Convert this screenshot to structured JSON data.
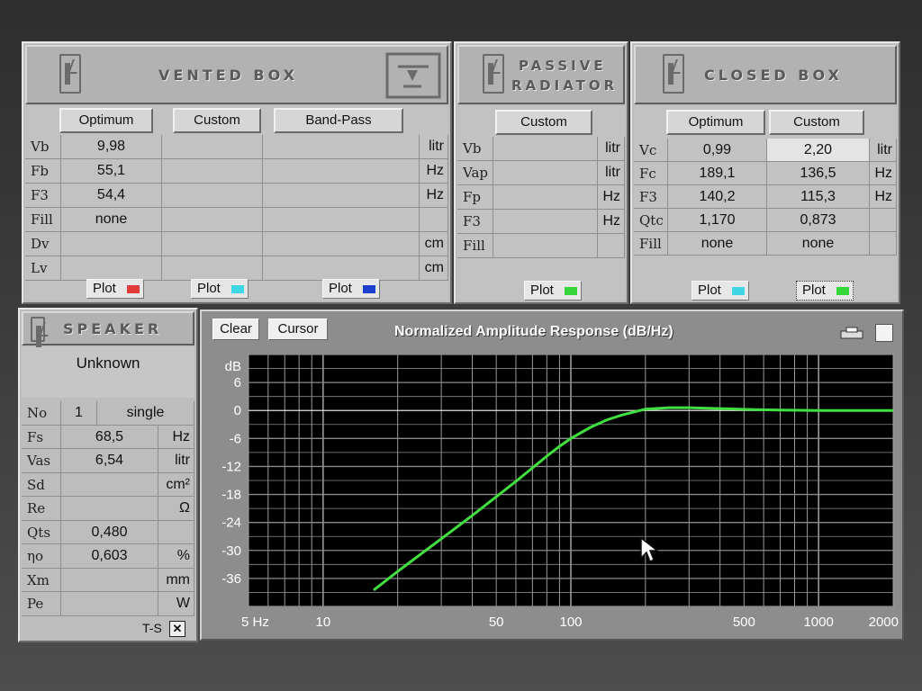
{
  "vented": {
    "title": "VENTED BOX",
    "columns": [
      "Optimum",
      "Custom",
      "Band-Pass"
    ],
    "rows": [
      {
        "label": "Vb",
        "values": [
          "9,98",
          "",
          ""
        ],
        "unit": "litr"
      },
      {
        "label": "Fb",
        "values": [
          "55,1",
          "",
          ""
        ],
        "unit": "Hz"
      },
      {
        "label": "F3",
        "values": [
          "54,4",
          "",
          ""
        ],
        "unit": "Hz"
      },
      {
        "label": "Fill",
        "values": [
          "none",
          "",
          ""
        ],
        "unit": ""
      },
      {
        "label": "Dv",
        "values": [
          "",
          "",
          ""
        ],
        "unit": "cm"
      },
      {
        "label": "Lv",
        "values": [
          "",
          "",
          ""
        ],
        "unit": "cm"
      }
    ],
    "plot_label": "Plot",
    "plot_colors": [
      "#e23b3b",
      "#3fd6e6",
      "#1f3fd0"
    ]
  },
  "passive": {
    "title_line1": "PASSIVE",
    "title_line2": "RADIATOR",
    "column": "Custom",
    "rows": [
      {
        "label": "Vb",
        "value": "",
        "unit": "litr"
      },
      {
        "label": "Vap",
        "value": "",
        "unit": "litr"
      },
      {
        "label": "Fp",
        "value": "",
        "unit": "Hz"
      },
      {
        "label": "F3",
        "value": "",
        "unit": "Hz"
      },
      {
        "label": "Fill",
        "value": "",
        "unit": ""
      }
    ],
    "plot_label": "Plot",
    "plot_color": "#35d63a"
  },
  "closed": {
    "title": "CLOSED BOX",
    "columns": [
      "Optimum",
      "Custom"
    ],
    "rows": [
      {
        "label": "Vc",
        "values": [
          "0,99",
          "2,20"
        ],
        "unit": "litr"
      },
      {
        "label": "Fc",
        "values": [
          "189,1",
          "136,5"
        ],
        "unit": "Hz"
      },
      {
        "label": "F3",
        "values": [
          "140,2",
          "115,3"
        ],
        "unit": "Hz"
      },
      {
        "label": "Qtc",
        "values": [
          "1,170",
          "0,873"
        ],
        "unit": ""
      },
      {
        "label": "Fill",
        "values": [
          "none",
          "none"
        ],
        "unit": ""
      }
    ],
    "plot_label": "Plot",
    "plot_colors": [
      "#3fd6e6",
      "#35d63a"
    ]
  },
  "speaker": {
    "title": "SPEAKER",
    "name": "Unknown",
    "no_label": "No",
    "no_value": "1",
    "no_mode": "single",
    "rows": [
      {
        "label": "Fs",
        "value": "68,5",
        "unit": "Hz"
      },
      {
        "label": "Vas",
        "value": "6,54",
        "unit": "litr"
      },
      {
        "label": "Sd",
        "value": "",
        "unit": "cm²"
      },
      {
        "label": "Re",
        "value": "",
        "unit": "Ω"
      },
      {
        "label": "Qts",
        "value": "0,480",
        "unit": ""
      },
      {
        "label": "ηo",
        "value": "0,603",
        "unit": "%"
      },
      {
        "label": "Xm",
        "value": "",
        "unit": "mm"
      },
      {
        "label": "Pe",
        "value": "",
        "unit": "W"
      }
    ],
    "ts_label": "T-S",
    "ts_checkbox": "✕"
  },
  "graph": {
    "clear_label": "Clear",
    "cursor_label": "Cursor",
    "title": "Normalized Amplitude Response (dB/Hz)"
  },
  "chart_data": {
    "type": "line",
    "title": "Normalized Amplitude Response (dB/Hz)",
    "xlabel": "Hz",
    "ylabel": "dB",
    "x_scale": "log",
    "xlim": [
      5,
      2000
    ],
    "ylim": [
      -42,
      12
    ],
    "y_ticks": [
      6,
      0,
      -6,
      -12,
      -18,
      -24,
      -30,
      -36
    ],
    "x_tick_labels": [
      "5 Hz",
      "10",
      "50",
      "100",
      "500",
      "1000",
      "2000"
    ],
    "x_tick_values": [
      5,
      10,
      50,
      100,
      500,
      1000,
      2000
    ],
    "grid": true,
    "series": [
      {
        "color": "#3fe03f",
        "x": [
          16,
          20,
          30,
          40,
          50,
          60,
          70,
          80,
          90,
          100,
          120,
          140,
          160,
          200,
          250,
          300,
          400,
          550,
          700,
          1000,
          1500,
          2000
        ],
        "y": [
          -38.5,
          -34.5,
          -27.5,
          -22.5,
          -18.5,
          -15.2,
          -12.3,
          -9.8,
          -7.7,
          -6.0,
          -3.6,
          -2.0,
          -1.0,
          0.3,
          0.6,
          0.6,
          0.4,
          0.2,
          0.1,
          0.0,
          0.0,
          0.0
        ]
      }
    ]
  }
}
